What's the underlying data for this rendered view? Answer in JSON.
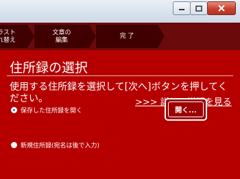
{
  "steps": [
    {
      "line1": "ラスト",
      "line2": "れ替え"
    },
    {
      "line1": "文章の",
      "line2": "編集"
    },
    {
      "line1": "完 了",
      "line2": ""
    }
  ],
  "window_controls": [
    "minimize-icon",
    "maximize-icon",
    "close-icon"
  ],
  "main": {
    "title": "住所録の選択",
    "description": "使用する住所録を選択して[次へ]ボタンを押してください。",
    "link": ">>> 詳しい説明を見る",
    "options": [
      {
        "label": "保存した住所録を開く",
        "selected": true
      },
      {
        "label": "新規住所録(宛名は後で入力)",
        "selected": false
      }
    ],
    "open_button": "開く..."
  },
  "colors": {
    "background": "#b60000",
    "step_bar": "#6b0a0a",
    "step": "#400000"
  }
}
